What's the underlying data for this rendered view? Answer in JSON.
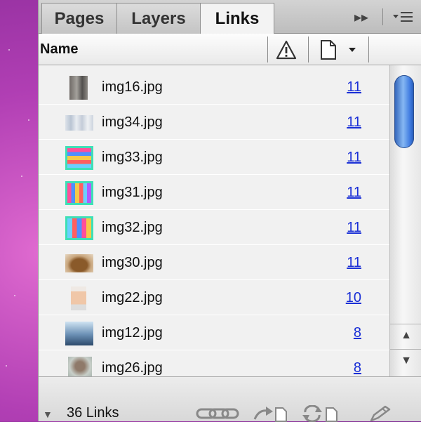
{
  "tabs": [
    {
      "label": "Pages",
      "active": false
    },
    {
      "label": "Layers",
      "active": false
    },
    {
      "label": "Links",
      "active": true
    }
  ],
  "header": {
    "name_label": "Name",
    "status_icon": "warning-triangle-icon",
    "page_icon": "page-icon"
  },
  "links": [
    {
      "name": "img16.jpg",
      "page": "11",
      "thumb": "gray-tall"
    },
    {
      "name": "img34.jpg",
      "page": "11",
      "thumb": "pale-rows"
    },
    {
      "name": "img33.jpg",
      "page": "11",
      "thumb": "stripes-horizontal"
    },
    {
      "name": "img31.jpg",
      "page": "11",
      "thumb": "stripes-vertical"
    },
    {
      "name": "img32.jpg",
      "page": "11",
      "thumb": "stripes-vertical-2"
    },
    {
      "name": "img30.jpg",
      "page": "11",
      "thumb": "brown-object"
    },
    {
      "name": "img22.jpg",
      "page": "10",
      "thumb": "sculpture"
    },
    {
      "name": "img12.jpg",
      "page": "8",
      "thumb": "blue-interior"
    },
    {
      "name": "img26.jpg",
      "page": "8",
      "thumb": "figure"
    }
  ],
  "footer": {
    "count_label": "36 Links",
    "icons": [
      "relink-icon",
      "go-to-link-icon",
      "update-link-icon",
      "edit-original-icon"
    ]
  },
  "colors": {
    "page_link": "#1a2fd6",
    "scroll_thumb": "#3f7be0",
    "desktop": "#b13fb4"
  }
}
